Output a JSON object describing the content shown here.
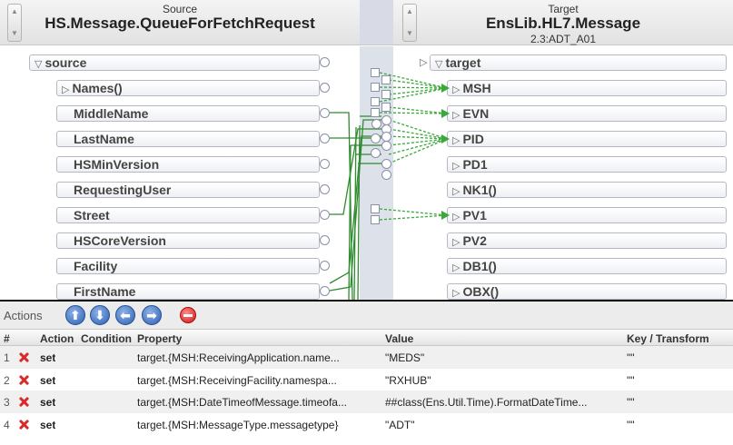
{
  "source_header": {
    "caption": "Source",
    "name": "HS.Message.QueueForFetchRequest"
  },
  "target_header": {
    "caption": "Target",
    "name": "EnsLib.HL7.Message",
    "subtitle": "2.3:ADT_A01"
  },
  "source_tree": {
    "root": "source",
    "fields": [
      "Names()",
      "MiddleName",
      "LastName",
      "HSMinVersion",
      "RequestingUser",
      "Street",
      "HSCoreVersion",
      "Facility",
      "FirstName"
    ]
  },
  "target_tree": {
    "root": "target",
    "segments": [
      "MSH",
      "EVN",
      "PID",
      "PD1",
      "NK1()",
      "PV1",
      "PV2",
      "DB1()",
      "OBX()"
    ]
  },
  "actions": {
    "label": "Actions",
    "buttons": {
      "move_up": "⬆",
      "move_down": "⬇",
      "move_left": "⬅",
      "move_right": "➡"
    }
  },
  "table": {
    "columns": {
      "num": "#",
      "action": "Action",
      "condition": "Condition",
      "property": "Property",
      "value": "Value",
      "key": "Key / Transform"
    },
    "rows": [
      {
        "num": "1",
        "action": "set",
        "condition": "",
        "property": "target.{MSH:ReceivingApplication.name...",
        "value": "\"MEDS\"",
        "key": "\"\""
      },
      {
        "num": "2",
        "action": "set",
        "condition": "",
        "property": "target.{MSH:ReceivingFacility.namespa...",
        "value": "\"RXHUB\"",
        "key": "\"\""
      },
      {
        "num": "3",
        "action": "set",
        "condition": "",
        "property": "target.{MSH:DateTimeofMessage.timeofa...",
        "value": "##class(Ens.Util.Time).FormatDateTime...",
        "key": "\"\""
      },
      {
        "num": "4",
        "action": "set",
        "condition": "",
        "property": "target.{MSH:MessageType.messagetype}",
        "value": "\"ADT\"",
        "key": "\"\""
      }
    ]
  },
  "colors": {
    "link_solid": "#2e8b2e",
    "link_dashed": "#3aa83a",
    "delete_red": "#d31616",
    "nav_blue": "#2b5fb3"
  }
}
